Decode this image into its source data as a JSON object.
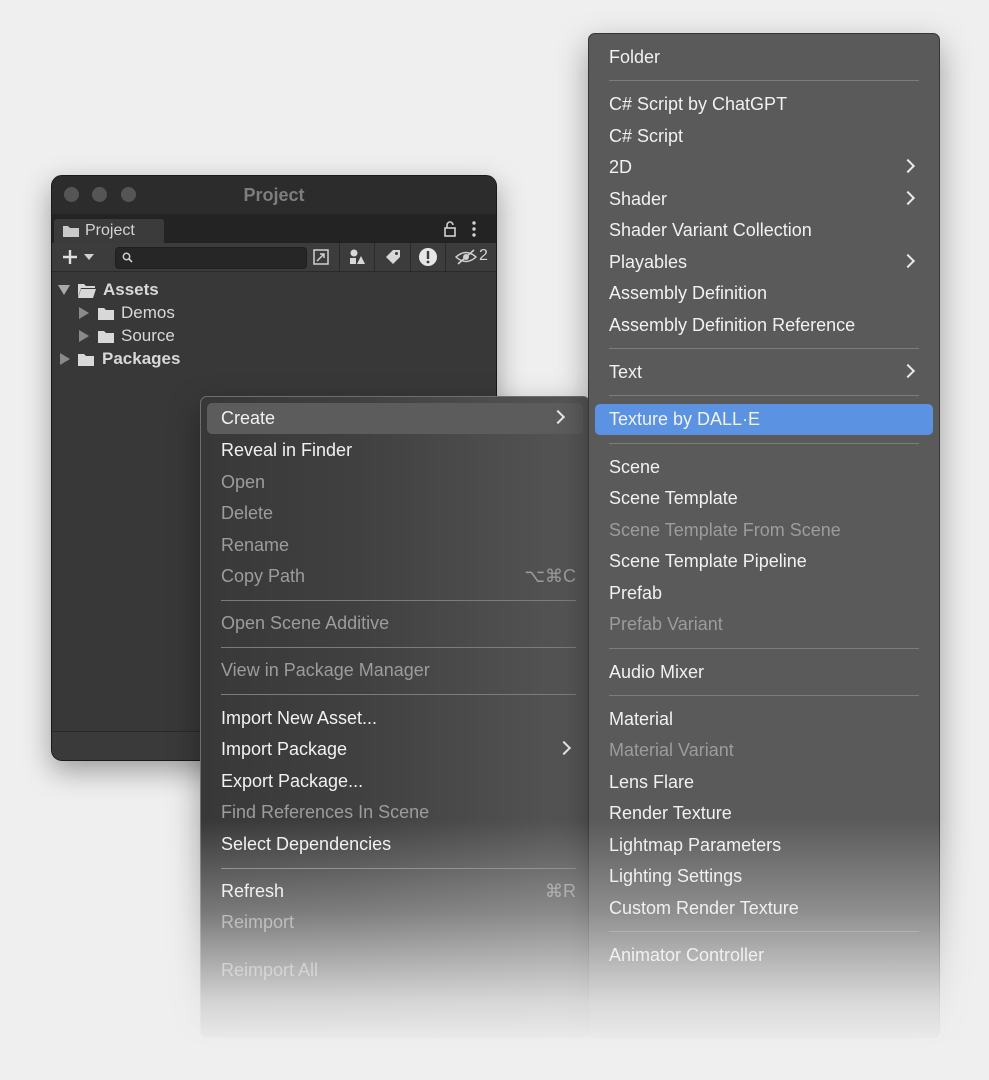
{
  "window": {
    "title": "Project",
    "tab_label": "Project",
    "hidden_count": "2",
    "search_placeholder": ""
  },
  "tree": [
    {
      "label": "Assets",
      "expanded": true,
      "icon": "folder-open-icon"
    },
    {
      "label": "Demos",
      "expanded": false,
      "icon": "folder-icon"
    },
    {
      "label": "Source",
      "expanded": false,
      "icon": "folder-icon"
    },
    {
      "label": "Packages",
      "expanded": false,
      "icon": "folder-icon"
    }
  ],
  "context_menu": {
    "items": [
      {
        "label": "Create",
        "enabled": true,
        "submenu": true,
        "highlighted": true
      },
      {
        "label": "Reveal in Finder",
        "enabled": true
      },
      {
        "label": "Open",
        "enabled": false
      },
      {
        "label": "Delete",
        "enabled": false
      },
      {
        "label": "Rename",
        "enabled": false
      },
      {
        "label": "Copy Path",
        "enabled": false,
        "shortcut": "⌥⌘C"
      },
      {
        "label": "Open Scene Additive",
        "enabled": false
      },
      {
        "label": "View in Package Manager",
        "enabled": false
      },
      {
        "label": "Import New Asset...",
        "enabled": true
      },
      {
        "label": "Import Package",
        "enabled": true,
        "submenu": true
      },
      {
        "label": "Export Package...",
        "enabled": true
      },
      {
        "label": "Find References In Scene",
        "enabled": false
      },
      {
        "label": "Select Dependencies",
        "enabled": true
      },
      {
        "label": "Refresh",
        "enabled": true,
        "shortcut": "⌘R"
      },
      {
        "label": "Reimport",
        "enabled": false
      },
      {
        "label": "Reimport All",
        "enabled": false
      }
    ]
  },
  "create_menu": {
    "items": [
      {
        "label": "Folder",
        "enabled": true
      },
      {
        "label": "C# Script by ChatGPT",
        "enabled": true
      },
      {
        "label": "C# Script",
        "enabled": true
      },
      {
        "label": "2D",
        "enabled": true,
        "submenu": true
      },
      {
        "label": "Shader",
        "enabled": true,
        "submenu": true
      },
      {
        "label": "Shader Variant Collection",
        "enabled": true
      },
      {
        "label": "Playables",
        "enabled": true,
        "submenu": true
      },
      {
        "label": "Assembly Definition",
        "enabled": true
      },
      {
        "label": "Assembly Definition Reference",
        "enabled": true
      },
      {
        "label": "Text",
        "enabled": true,
        "submenu": true
      },
      {
        "label": "Texture by DALL·E",
        "enabled": true,
        "selected": true
      },
      {
        "label": "Scene",
        "enabled": true
      },
      {
        "label": "Scene Template",
        "enabled": true
      },
      {
        "label": "Scene Template From Scene",
        "enabled": false
      },
      {
        "label": "Scene Template Pipeline",
        "enabled": true
      },
      {
        "label": "Prefab",
        "enabled": true
      },
      {
        "label": "Prefab Variant",
        "enabled": false
      },
      {
        "label": "Audio Mixer",
        "enabled": true
      },
      {
        "label": "Material",
        "enabled": true
      },
      {
        "label": "Material Variant",
        "enabled": false
      },
      {
        "label": "Lens Flare",
        "enabled": true
      },
      {
        "label": "Render Texture",
        "enabled": true
      },
      {
        "label": "Lightmap Parameters",
        "enabled": true
      },
      {
        "label": "Lighting Settings",
        "enabled": true
      },
      {
        "label": "Custom Render Texture",
        "enabled": true
      },
      {
        "label": "Animator Controller",
        "enabled": true
      }
    ]
  },
  "colors": {
    "selection": "#5b93e2",
    "background": "#efefef"
  }
}
